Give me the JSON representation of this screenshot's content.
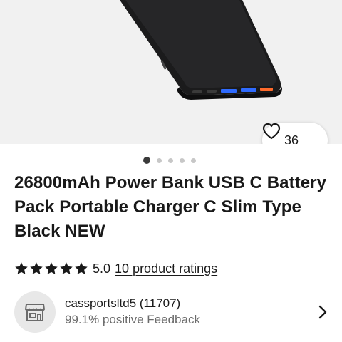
{
  "listing": {
    "watch_count": "36",
    "image_dots": 5,
    "active_dot": 0,
    "title": "26800mAh Power Bank USB C Battery Pack Portable Charger C Slim Type Black NEW"
  },
  "rating": {
    "stars": 5,
    "value": "5.0",
    "link_label": "10 product ratings"
  },
  "seller": {
    "name": "cassportsltd5 (11707)",
    "feedback": "99.1% positive Feedback",
    "avatar_icon": "store-icon"
  },
  "colors": {
    "hero_bg": "#f1f1f1",
    "text": "#191919",
    "secondary_text": "#6b6b6b",
    "usb_port_blue": "#2f6bff",
    "usb_port_orange": "#ff6a2b"
  }
}
